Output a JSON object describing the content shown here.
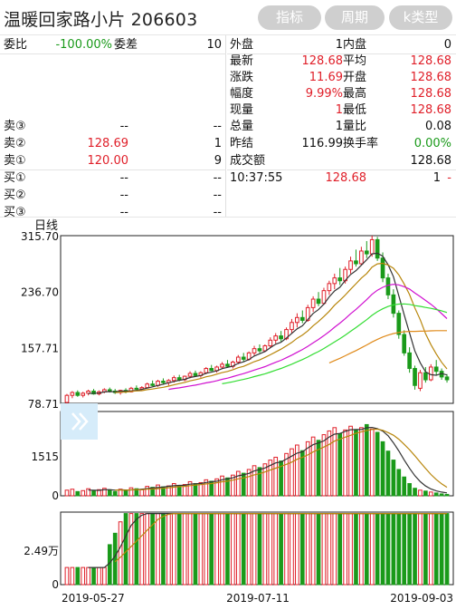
{
  "header": {
    "title": "温暖回家路小片 206603",
    "tabs": [
      "指标",
      "周期",
      "k类型"
    ]
  },
  "left_panel": {
    "weibi": {
      "label": "委比",
      "value": "-100.00%",
      "label2": "委差",
      "value2": "10"
    },
    "sells": [
      {
        "label": "卖③",
        "price": "--",
        "vol": "--"
      },
      {
        "label": "卖②",
        "price": "128.69",
        "vol": "1"
      },
      {
        "label": "卖①",
        "price": "120.00",
        "vol": "9"
      }
    ],
    "buys": [
      {
        "label": "买①",
        "price": "--",
        "vol": "--"
      },
      {
        "label": "买②",
        "price": "--",
        "vol": "--"
      },
      {
        "label": "买③",
        "price": "--",
        "vol": "--"
      }
    ]
  },
  "right_panel": {
    "rows": [
      {
        "l1": "外盘",
        "v1": "1",
        "l2": "内盘",
        "v2": "0"
      },
      {
        "l1": "最新",
        "v1": "128.68",
        "l2": "平均",
        "v2": "128.68"
      },
      {
        "l1": "涨跌",
        "v1": "11.69",
        "l2": "开盘",
        "v2": "128.68"
      },
      {
        "l1": "幅度",
        "v1": "9.99%",
        "l2": "最高",
        "v2": "128.68"
      },
      {
        "l1": "现量",
        "v1": "1",
        "l2": "最低",
        "v2": "128.68"
      },
      {
        "l1": "总量",
        "v1": "1",
        "l2": "量比",
        "v2": "0.08"
      },
      {
        "l1": "昨结",
        "v1": "116.99",
        "l2": "换手率",
        "v2": "0.00%"
      },
      {
        "l1": "成交额",
        "v1": "",
        "l2": "",
        "v2": "128.68"
      }
    ],
    "trade": {
      "time": "10:37:55",
      "price": "128.68",
      "vol": "1",
      "flag": "-"
    }
  },
  "colors": {
    "up": "#e0202a",
    "down": "#1a9a1a",
    "ma5": "#333333",
    "ma10": "#b8860b",
    "ma20": "#d010d0",
    "ma30": "#33dd33",
    "ma60": "#e08a1a"
  },
  "chart_data": {
    "type": "candlestick",
    "period_label": "日线",
    "y_ticks": [
      "315.70",
      "236.70",
      "157.71",
      "78.71"
    ],
    "y_range": [
      78.71,
      315.7
    ],
    "x_labels": [
      "2019-05-27",
      "2019-07-11",
      "2019-09-03"
    ],
    "volume_ticks": [
      "1515",
      "0"
    ],
    "amount_ticks": [
      "2.49万",
      "0"
    ],
    "candles": [
      {
        "o": 80,
        "h": 92,
        "l": 78.7,
        "c": 90
      },
      {
        "o": 90,
        "h": 96,
        "l": 86,
        "c": 94
      },
      {
        "o": 94,
        "h": 97,
        "l": 88,
        "c": 90
      },
      {
        "o": 90,
        "h": 95,
        "l": 87,
        "c": 93
      },
      {
        "o": 93,
        "h": 98,
        "l": 90,
        "c": 96
      },
      {
        "o": 96,
        "h": 99,
        "l": 91,
        "c": 92
      },
      {
        "o": 92,
        "h": 97,
        "l": 90,
        "c": 95
      },
      {
        "o": 95,
        "h": 100,
        "l": 93,
        "c": 98
      },
      {
        "o": 98,
        "h": 101,
        "l": 94,
        "c": 96
      },
      {
        "o": 96,
        "h": 99,
        "l": 92,
        "c": 94
      },
      {
        "o": 94,
        "h": 98,
        "l": 91,
        "c": 97
      },
      {
        "o": 97,
        "h": 100,
        "l": 93,
        "c": 95
      },
      {
        "o": 95,
        "h": 102,
        "l": 94,
        "c": 100
      },
      {
        "o": 100,
        "h": 104,
        "l": 97,
        "c": 99
      },
      {
        "o": 99,
        "h": 103,
        "l": 96,
        "c": 101
      },
      {
        "o": 101,
        "h": 108,
        "l": 100,
        "c": 106
      },
      {
        "o": 106,
        "h": 111,
        "l": 103,
        "c": 104
      },
      {
        "o": 104,
        "h": 112,
        "l": 102,
        "c": 110
      },
      {
        "o": 110,
        "h": 114,
        "l": 106,
        "c": 108
      },
      {
        "o": 108,
        "h": 113,
        "l": 104,
        "c": 111
      },
      {
        "o": 111,
        "h": 118,
        "l": 108,
        "c": 115
      },
      {
        "o": 115,
        "h": 119,
        "l": 110,
        "c": 112
      },
      {
        "o": 112,
        "h": 118,
        "l": 110,
        "c": 117
      },
      {
        "o": 117,
        "h": 124,
        "l": 114,
        "c": 121
      },
      {
        "o": 121,
        "h": 125,
        "l": 116,
        "c": 118
      },
      {
        "o": 118,
        "h": 124,
        "l": 115,
        "c": 122
      },
      {
        "o": 122,
        "h": 130,
        "l": 120,
        "c": 128
      },
      {
        "o": 128,
        "h": 133,
        "l": 124,
        "c": 125
      },
      {
        "o": 125,
        "h": 132,
        "l": 122,
        "c": 130
      },
      {
        "o": 130,
        "h": 137,
        "l": 127,
        "c": 134
      },
      {
        "o": 134,
        "h": 140,
        "l": 129,
        "c": 131
      },
      {
        "o": 131,
        "h": 139,
        "l": 128,
        "c": 137
      },
      {
        "o": 137,
        "h": 147,
        "l": 134,
        "c": 144
      },
      {
        "o": 144,
        "h": 150,
        "l": 138,
        "c": 141
      },
      {
        "o": 141,
        "h": 152,
        "l": 139,
        "c": 150
      },
      {
        "o": 150,
        "h": 160,
        "l": 146,
        "c": 156
      },
      {
        "o": 156,
        "h": 162,
        "l": 150,
        "c": 153
      },
      {
        "o": 153,
        "h": 162,
        "l": 151,
        "c": 160
      },
      {
        "o": 160,
        "h": 172,
        "l": 157,
        "c": 168
      },
      {
        "o": 168,
        "h": 178,
        "l": 163,
        "c": 174
      },
      {
        "o": 174,
        "h": 181,
        "l": 166,
        "c": 170
      },
      {
        "o": 170,
        "h": 186,
        "l": 168,
        "c": 183
      },
      {
        "o": 183,
        "h": 198,
        "l": 178,
        "c": 193
      },
      {
        "o": 193,
        "h": 206,
        "l": 186,
        "c": 200
      },
      {
        "o": 200,
        "h": 210,
        "l": 192,
        "c": 196
      },
      {
        "o": 196,
        "h": 218,
        "l": 194,
        "c": 214
      },
      {
        "o": 214,
        "h": 230,
        "l": 208,
        "c": 226
      },
      {
        "o": 226,
        "h": 236,
        "l": 216,
        "c": 220
      },
      {
        "o": 220,
        "h": 242,
        "l": 218,
        "c": 238
      },
      {
        "o": 238,
        "h": 252,
        "l": 232,
        "c": 248
      },
      {
        "o": 248,
        "h": 262,
        "l": 240,
        "c": 256
      },
      {
        "o": 256,
        "h": 270,
        "l": 246,
        "c": 252
      },
      {
        "o": 252,
        "h": 272,
        "l": 248,
        "c": 268
      },
      {
        "o": 268,
        "h": 286,
        "l": 262,
        "c": 280
      },
      {
        "o": 280,
        "h": 296,
        "l": 272,
        "c": 276
      },
      {
        "o": 276,
        "h": 300,
        "l": 274,
        "c": 294
      },
      {
        "o": 294,
        "h": 308,
        "l": 284,
        "c": 290
      },
      {
        "o": 290,
        "h": 315.7,
        "l": 286,
        "c": 310
      },
      {
        "o": 310,
        "h": 314,
        "l": 280,
        "c": 284
      },
      {
        "o": 284,
        "h": 292,
        "l": 250,
        "c": 256
      },
      {
        "o": 256,
        "h": 262,
        "l": 226,
        "c": 232
      },
      {
        "o": 232,
        "h": 240,
        "l": 200,
        "c": 206
      },
      {
        "o": 206,
        "h": 210,
        "l": 170,
        "c": 176
      },
      {
        "o": 176,
        "h": 182,
        "l": 146,
        "c": 150
      },
      {
        "o": 150,
        "h": 158,
        "l": 122,
        "c": 128
      },
      {
        "o": 128,
        "h": 132,
        "l": 98,
        "c": 104
      },
      {
        "o": 100,
        "h": 126,
        "l": 96,
        "c": 122
      },
      {
        "o": 122,
        "h": 130,
        "l": 108,
        "c": 112
      },
      {
        "o": 112,
        "h": 134,
        "l": 110,
        "c": 130
      },
      {
        "o": 130,
        "h": 140,
        "l": 118,
        "c": 124
      },
      {
        "o": 124,
        "h": 128,
        "l": 112,
        "c": 116
      },
      {
        "o": 116,
        "h": 120,
        "l": 108,
        "c": 112
      }
    ],
    "volumes": [
      120,
      140,
      90,
      110,
      150,
      100,
      130,
      160,
      120,
      90,
      140,
      110,
      170,
      150,
      130,
      200,
      180,
      230,
      190,
      210,
      260,
      220,
      240,
      300,
      260,
      280,
      340,
      310,
      360,
      420,
      380,
      440,
      520,
      480,
      560,
      640,
      600,
      680,
      760,
      820,
      740,
      900,
      1000,
      1080,
      960,
      1150,
      1250,
      1180,
      1300,
      1380,
      1450,
      1320,
      1400,
      1480,
      1400,
      1450,
      1515,
      1420,
      1350,
      1150,
      950,
      760,
      560,
      400,
      260,
      160,
      120,
      100,
      80,
      60,
      40,
      30
    ],
    "amounts": [
      0.6,
      0.6,
      0.6,
      0.6,
      0.6,
      0.6,
      0.6,
      0.6,
      1.4,
      1.8,
      2.2,
      2.49,
      2.49,
      2.49,
      2.49,
      2.49,
      2.49,
      2.49,
      2.49,
      2.49,
      2.49,
      2.49,
      2.49,
      2.49,
      2.49,
      2.49,
      2.49,
      2.49,
      2.49,
      2.49,
      2.49,
      2.49,
      2.49,
      2.49,
      2.49,
      2.49,
      2.49,
      2.49,
      2.49,
      2.49,
      2.49,
      2.49,
      2.49,
      2.49,
      2.49,
      2.49,
      2.49,
      2.49,
      2.49,
      2.49,
      2.49,
      2.49,
      2.49,
      2.49,
      2.49,
      2.49,
      2.49,
      2.49,
      2.49,
      2.49,
      2.49,
      2.49,
      2.49,
      2.49,
      2.49,
      2.49,
      2.49,
      2.49,
      2.49,
      2.49,
      2.49,
      2.49
    ]
  }
}
